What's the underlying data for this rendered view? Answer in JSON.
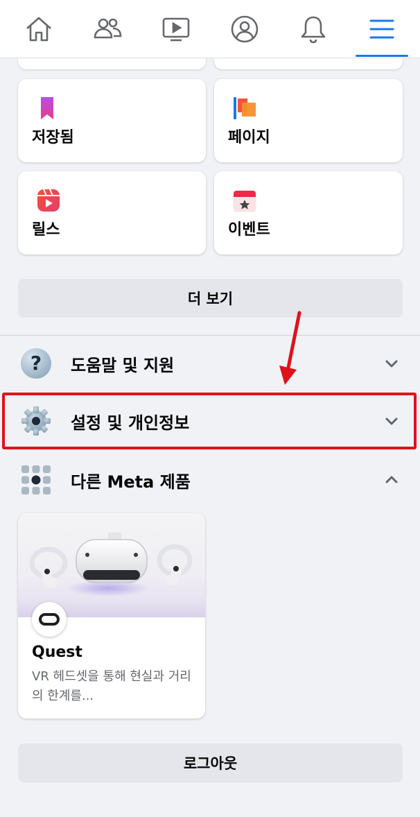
{
  "nav": {
    "items": [
      {
        "icon": "home-icon"
      },
      {
        "icon": "friends-icon"
      },
      {
        "icon": "watch-video-icon"
      },
      {
        "icon": "profile-icon"
      },
      {
        "icon": "notifications-bell-icon"
      },
      {
        "icon": "menu-icon",
        "active": true
      }
    ],
    "accent_color": "#1877f2"
  },
  "shortcuts": [
    {
      "label": "저장됨",
      "icon": "bookmark-icon"
    },
    {
      "label": "페이지",
      "icon": "flag-icon"
    },
    {
      "label": "릴스",
      "icon": "reels-icon"
    },
    {
      "label": "이벤트",
      "icon": "calendar-star-icon"
    }
  ],
  "more_button": "더 보기",
  "sections": [
    {
      "label": "도움말 및 지원",
      "icon": "question-icon",
      "expanded": false
    },
    {
      "label": "설정 및 개인정보",
      "icon": "gear-icon",
      "expanded": false,
      "highlighted": true
    },
    {
      "label": "다른 Meta 제품",
      "icon": "grid-icon",
      "expanded": true
    }
  ],
  "meta_products": [
    {
      "title": "Quest",
      "description": "VR 헤드셋을 통해 현실과 거리의 한계를...",
      "badge_icon": "oculus-icon"
    }
  ],
  "logout_button": "로그아웃",
  "annotation": {
    "highlight_color": "#e0111b"
  }
}
